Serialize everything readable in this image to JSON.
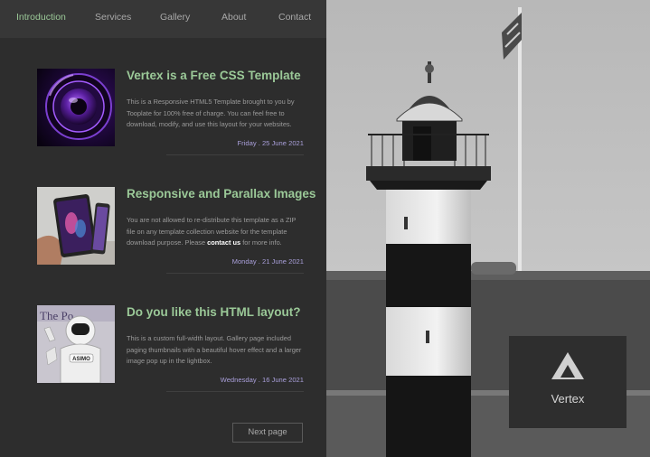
{
  "nav": {
    "items": [
      {
        "label": "Introduction",
        "active": true
      },
      {
        "label": "Services",
        "active": false
      },
      {
        "label": "Gallery",
        "active": false
      },
      {
        "label": "About",
        "active": false
      },
      {
        "label": "Contact",
        "active": false
      }
    ]
  },
  "posts": [
    {
      "title": "Vertex is a Free CSS Template",
      "body": "This is a Responsive HTML5 Template brought to you by Tooplate for 100% free of charge. You can feel free to download, modify, and use this layout for your websites.",
      "date": "Friday . 25 June 2021",
      "image": "purple-camera-lens"
    },
    {
      "title": "Responsive and Parallax Images",
      "body_before": "You are not allowed to re-distribute this template as a ZIP file on any template collection website for the template download purpose. Please ",
      "body_link": "contact us",
      "body_after": " for more info.",
      "date": "Monday . 21 June 2021",
      "image": "foldable-phone-in-hand"
    },
    {
      "title": "Do you like this HTML layout?",
      "body": "This is a custom full-width layout. Gallery page included paging thumbnails with a beautiful hover effect and a larger image pop up in the lightbox.",
      "date": "Wednesday . 16 June 2021",
      "image": "asimo-robot",
      "image_text": {
        "sign": "The Po",
        "badge": "ASIMO"
      }
    }
  ],
  "pagination": {
    "next_label": "Next page"
  },
  "brand": {
    "name": "Vertex",
    "logo_icon": "mountain-triangle-icon"
  },
  "colors": {
    "accent_green": "#9bc998",
    "date_purple": "#a99fda",
    "nav_bg": "#373737",
    "panel_bg": "#2d2d2d"
  }
}
